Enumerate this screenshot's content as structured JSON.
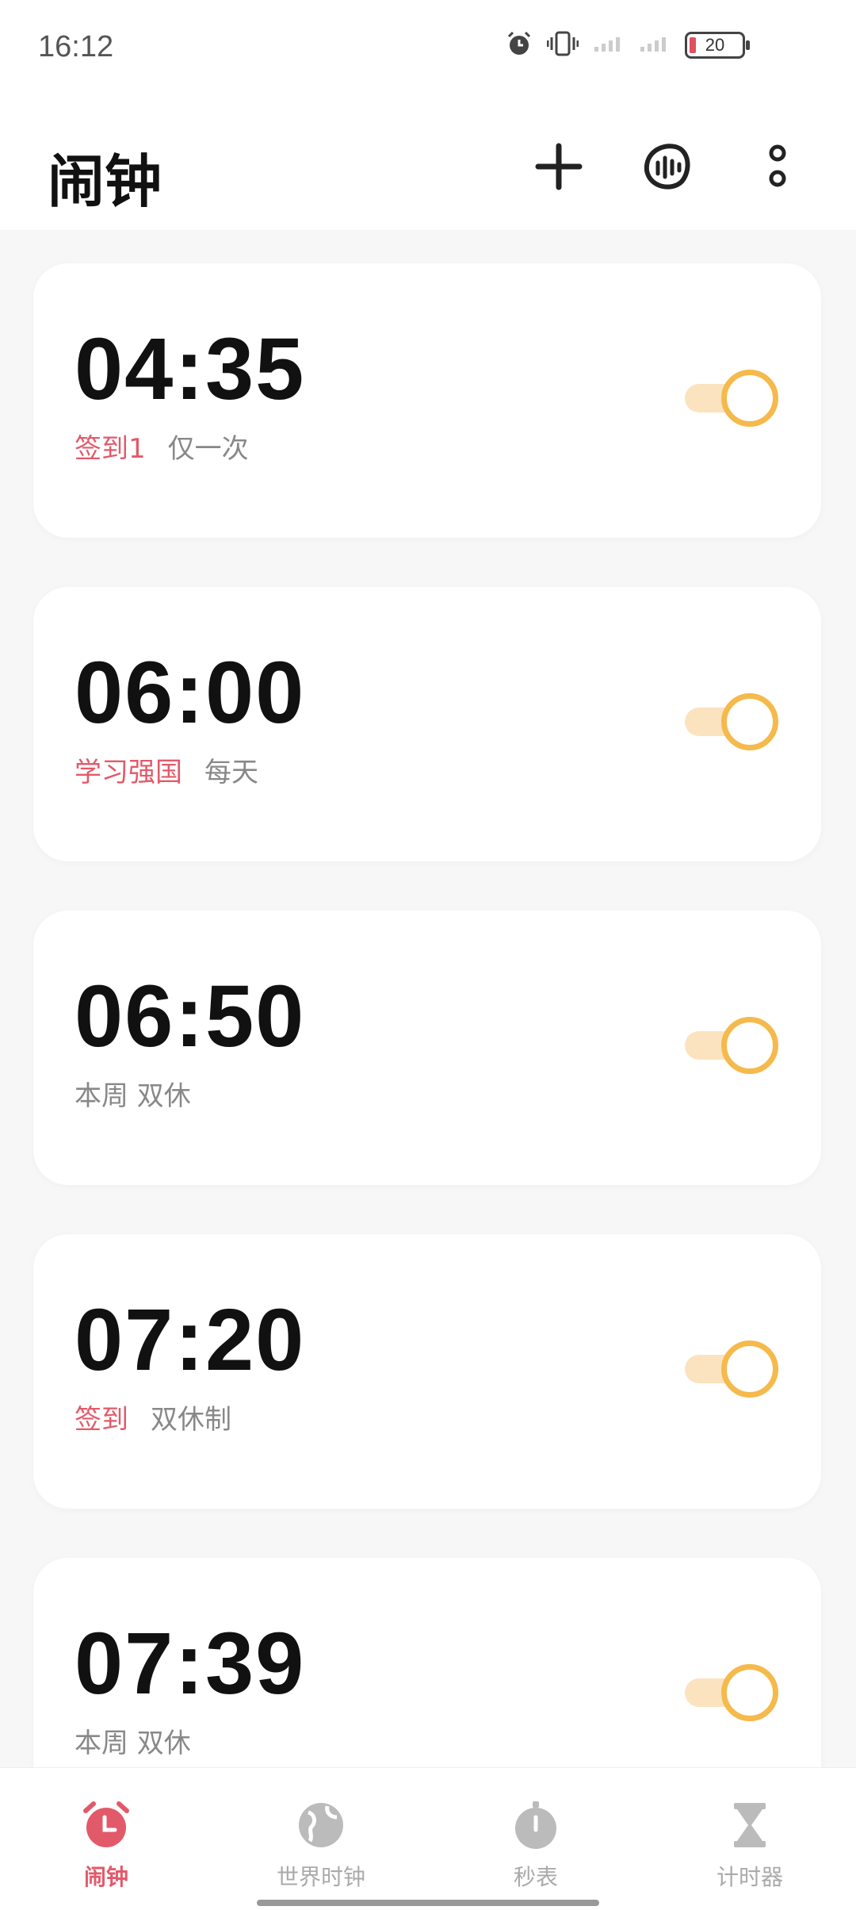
{
  "status_bar": {
    "time": "16:12",
    "battery": "20"
  },
  "header": {
    "title": "闹钟"
  },
  "alarms": [
    {
      "time": "04:35",
      "label": "签到1",
      "label_style": "red",
      "repeat": "仅一次",
      "enabled": true
    },
    {
      "time": "06:00",
      "label": "学习强国",
      "label_style": "red",
      "repeat": "每天",
      "enabled": true
    },
    {
      "time": "06:50",
      "label": "本周 双休",
      "label_style": "gray",
      "repeat": "",
      "enabled": true
    },
    {
      "time": "07:20",
      "label": "签到",
      "label_style": "red",
      "repeat": "双休制",
      "enabled": true
    },
    {
      "time": "07:39",
      "label": "本周 双休",
      "label_style": "gray",
      "repeat": "",
      "enabled": true
    }
  ],
  "bottom_nav": {
    "items": [
      {
        "label": "闹钟",
        "icon": "alarm-clock-icon",
        "active": true
      },
      {
        "label": "世界时钟",
        "icon": "globe-icon",
        "active": false
      },
      {
        "label": "秒表",
        "icon": "stopwatch-icon",
        "active": false
      },
      {
        "label": "计时器",
        "icon": "hourglass-icon",
        "active": false
      }
    ]
  },
  "colors": {
    "accent_red": "#e25a6a",
    "toggle_on": "#f5b94c",
    "toggle_track": "#fbe3bf"
  }
}
